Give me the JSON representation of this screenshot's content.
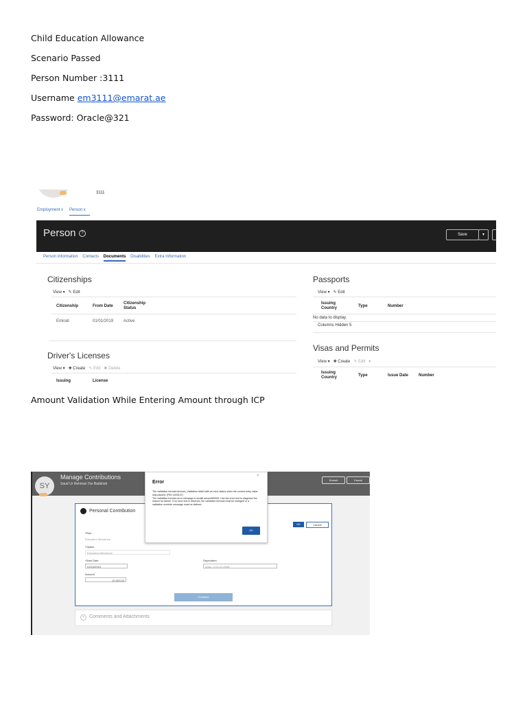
{
  "document": {
    "title": "Child Education Allowance",
    "status": "Scenario Passed",
    "person_number": "Person Number :3111",
    "username_label": "Username",
    "username_value": "em3111@emarat.ae",
    "password": "Password: Oracle@321",
    "caption_2": "Amount Validation While Entering Amount through ICP"
  },
  "screenshot1": {
    "person_number": "3111",
    "breadcrumbs": [
      "Employment x",
      "Person x"
    ],
    "page_title": "Person",
    "save_label": "Save",
    "save_dropdown": "▾",
    "tabs": [
      "Person Information",
      "Contacts",
      "Documents",
      "Disabilities",
      "Extra Information"
    ],
    "active_tab": "Documents",
    "citizenships": {
      "title": "Citizenships",
      "view_label": "View ▾",
      "edit_label": "Edit",
      "headers": [
        "Citizenship",
        "From Date",
        "Citizenship Status"
      ],
      "row": [
        "Emirati",
        "01/01/2019",
        "Active"
      ]
    },
    "passports": {
      "title": "Passports",
      "view_label": "View ▾",
      "edit_label": "Edit",
      "headers": [
        "Issuing Country",
        "Type",
        "Number"
      ],
      "empty": "No data to display.",
      "hidden": "Columns Hidden  5"
    },
    "drivers_licenses": {
      "title": "Driver's Licenses",
      "view_label": "View ▾",
      "create_label": "Create",
      "edit_label": "Edit",
      "delete_label": "Delete",
      "headers": [
        "Issuing",
        "License"
      ]
    },
    "visas": {
      "title": "Visas and Permits",
      "view_label": "View ▾",
      "create_label": "Create",
      "edit_label": "Edit",
      "more_label": "▾",
      "headers": [
        "Issuing Country",
        "Type",
        "Issue Date",
        "Number"
      ]
    }
  },
  "screenshot2": {
    "avatar_initials": "SY",
    "title": "Manage Contributions",
    "subtitle": "Saud Ur Rehman Yar Badshah",
    "submit_label": "Submit",
    "cancel_label": "Cancel",
    "panel_title": "Personal Contribution",
    "ok_label": "OK",
    "cancel2_label": "Cancel",
    "plan_label": "*Plan",
    "plan_value": "Education Allowance",
    "option_label": "*Option",
    "option_value": "Education Allowance",
    "start_date_label": "*Start Date",
    "start_date_value": "01/04/2024",
    "dependent_label": "Dependent",
    "dependent_value": "Ahan, d 01-01-2008",
    "amount_label": "Amount",
    "amount_value": "10,000.00",
    "continue_label": "Continue",
    "comments_label": "Comments and Attachments",
    "error_title": "Error",
    "error_close": "×",
    "error_message": "The validation formula Amount_Validation failed with an error status when the current entry value was passed. (PAY-1633147)\nThe validation formula error message is invalid amount80005. Use the error text to diagnose the reason for failure. If no error text is returned, the validation formula must be changed or a validation override message must be defined.",
    "error_ok": "OK"
  }
}
